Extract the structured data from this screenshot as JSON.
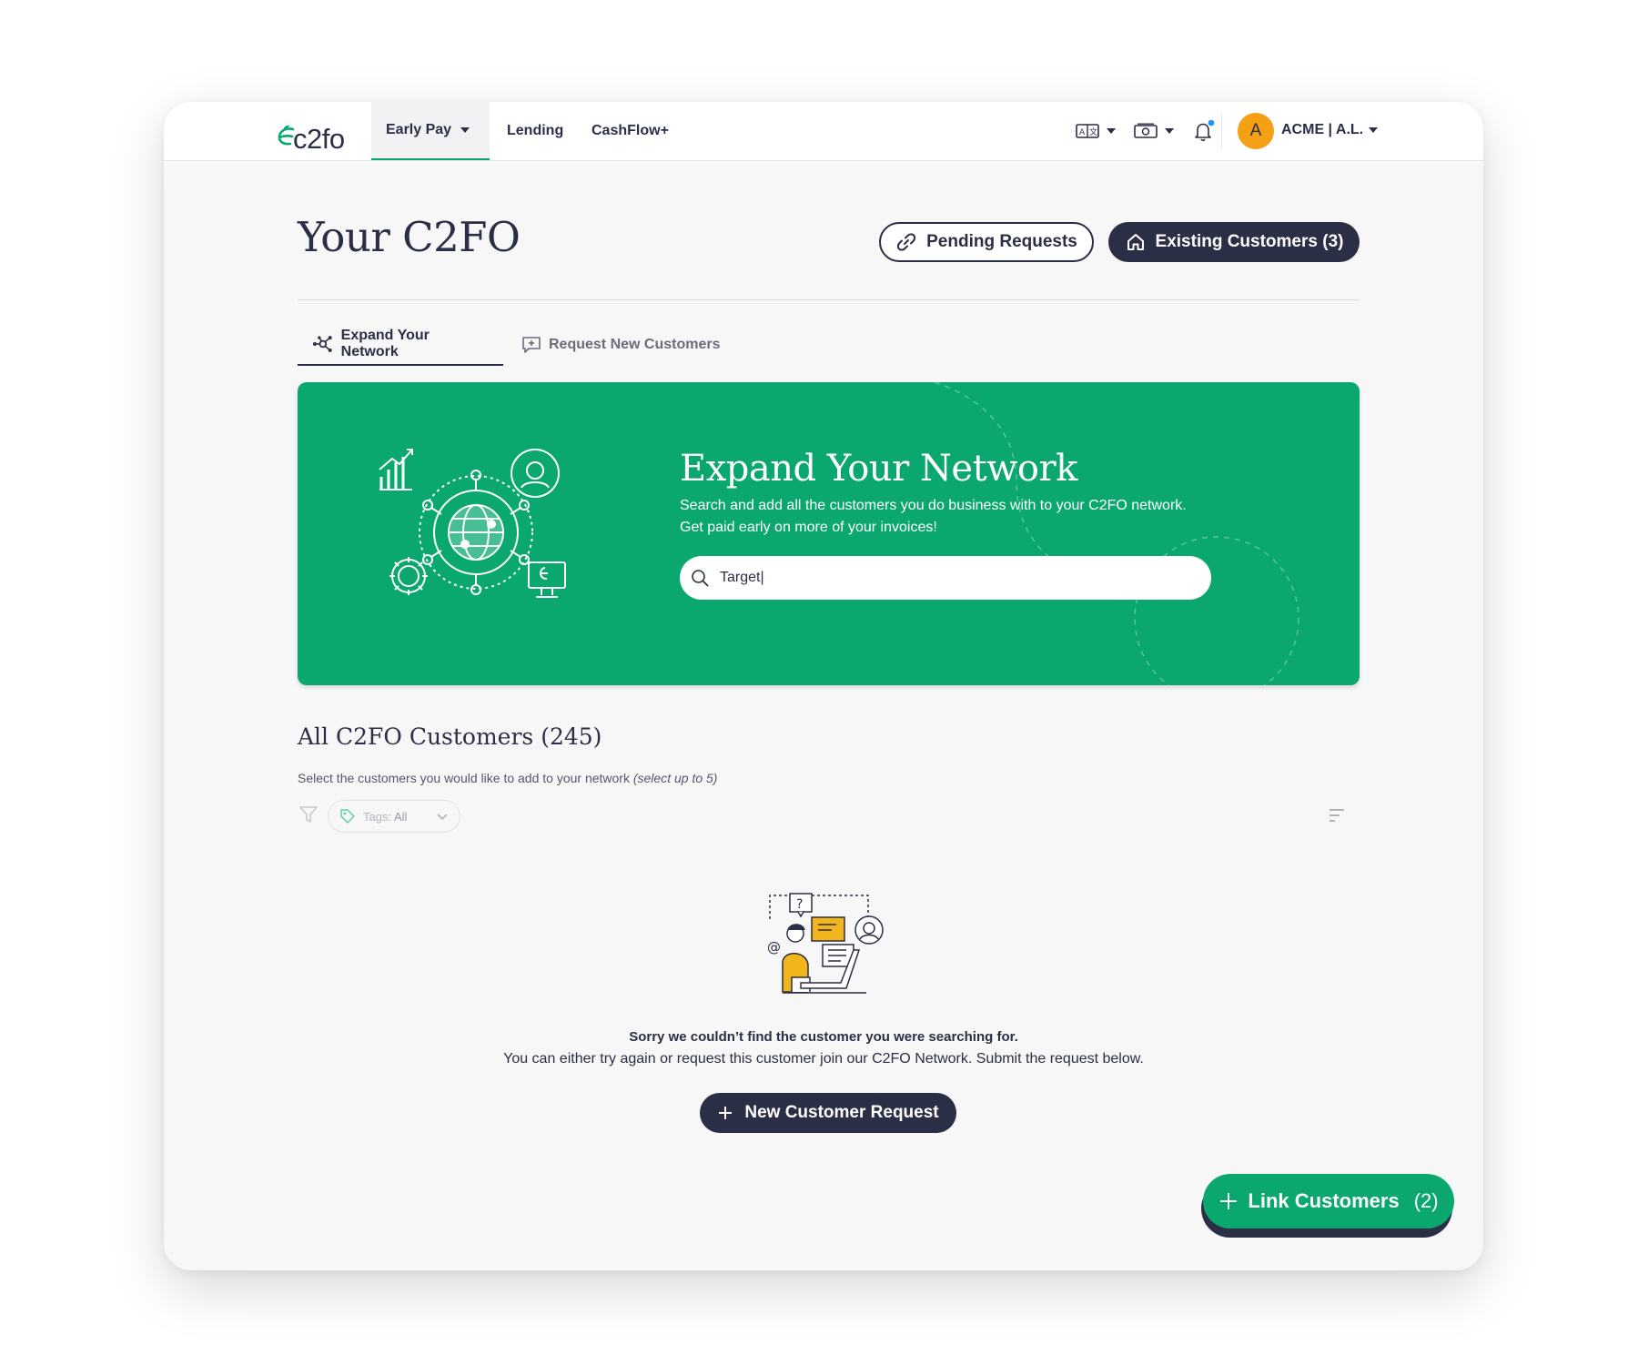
{
  "header": {
    "logo_text": "c2fo",
    "nav": [
      {
        "label": "Early Pay"
      },
      {
        "label": "Lending"
      },
      {
        "label": "CashFlow+"
      }
    ],
    "account_label": "ACME |  A.L.",
    "avatar_initial": "A"
  },
  "page": {
    "title": "Your C2FO",
    "pending_requests_label": "Pending Requests",
    "existing_customers_label": "Existing Customers (3)"
  },
  "tabs": [
    {
      "label": "Expand Your Network",
      "active": true
    },
    {
      "label": "Request New Customers",
      "active": false
    }
  ],
  "banner": {
    "title": "Expand Your Network",
    "subtitle_line1": "Search and add all the customers you do business with to your C2FO network.",
    "subtitle_line2": "Get paid early on more of your invoices!",
    "search_value": "Target|"
  },
  "customers": {
    "title": "All C2FO Customers (245)",
    "subtitle_main": "Select the customers you would like to add to your network ",
    "subtitle_note": "(select up to 5)",
    "tag_filter_prefix": "Tags: ",
    "tag_filter_value": "All"
  },
  "empty_state": {
    "heading": "Sorry we couldn’t find the customer you were searching for.",
    "body": "You can either try again or request this customer join our C2FO Network. Submit the request below.",
    "button_label": "New Customer Request"
  },
  "fab": {
    "label": "Link Customers",
    "count": "(2)"
  },
  "colors": {
    "brand_green": "#0aa86f",
    "navy": "#2b2f45",
    "avatar_orange": "#f3a014",
    "notification_dot": "#2196f3"
  }
}
